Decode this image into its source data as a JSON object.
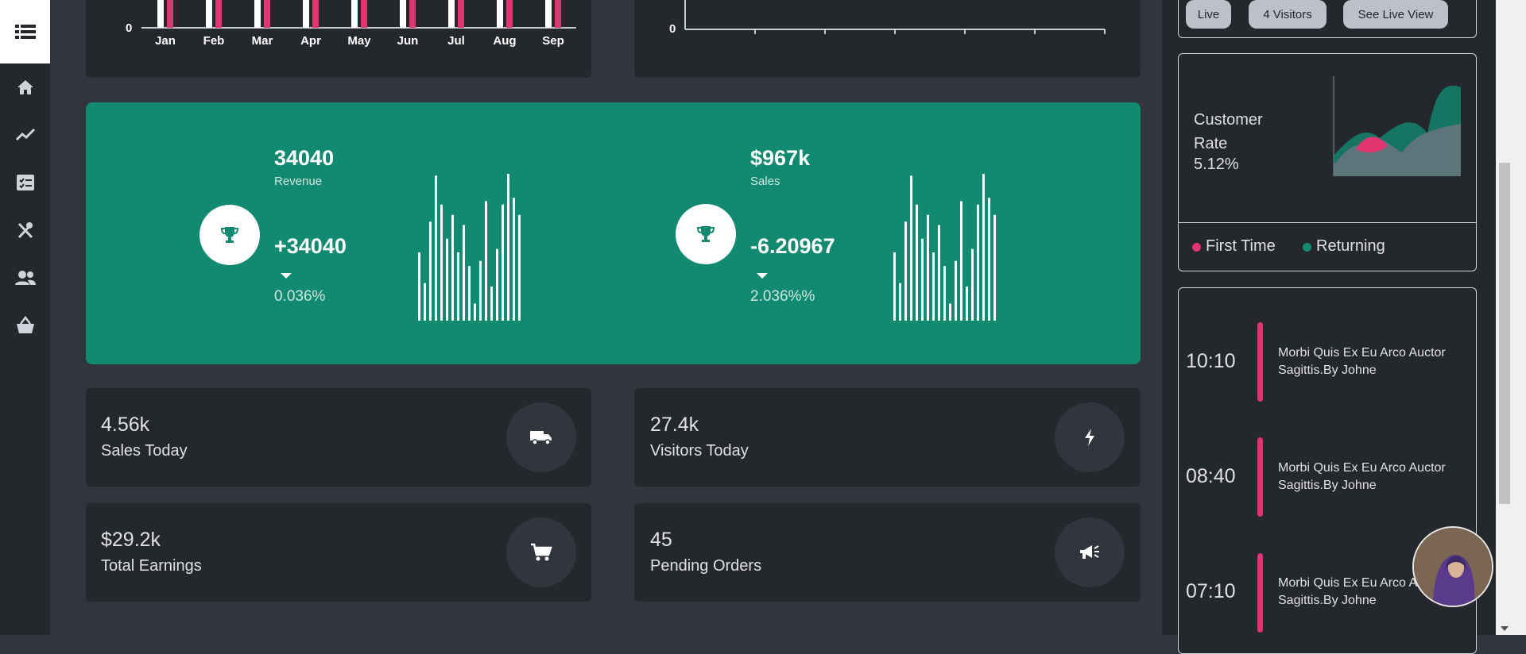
{
  "top_bar_chart": {
    "categories": [
      "Jan",
      "Feb",
      "Mar",
      "Apr",
      "May",
      "Jun",
      "Jul",
      "Aug",
      "Sep"
    ],
    "zero_label": "0",
    "white_bar_color": "#ffffff",
    "pink_bar_color": "#e0356f"
  },
  "top_line_chart": {
    "zero_label": "0"
  },
  "green_panel": {
    "accent": "#128971",
    "left": {
      "value": "34040",
      "label": "Revenue",
      "change": "+34040",
      "percent": "0.036%"
    },
    "right": {
      "value": "$967k",
      "label": "Sales",
      "change": "-6.20967",
      "percent": "2.036%%"
    },
    "sparkline_left": [
      40,
      22,
      58,
      85,
      68,
      48,
      62,
      40,
      56,
      32,
      10,
      35,
      70,
      20,
      42,
      68,
      86,
      72,
      62
    ],
    "sparkline_right": [
      40,
      22,
      58,
      85,
      68,
      48,
      62,
      40,
      56,
      32,
      10,
      35,
      70,
      20,
      42,
      68,
      86,
      72,
      62
    ]
  },
  "stats": [
    {
      "value": "4.56k",
      "label": "Sales Today",
      "icon": "truck-icon"
    },
    {
      "value": "27.4k",
      "label": "Visitors Today",
      "icon": "bolt-icon"
    },
    {
      "value": "$29.2k",
      "label": "Total Earnings",
      "icon": "cart-icon"
    },
    {
      "value": "45",
      "label": "Pending Orders",
      "icon": "megaphone-icon"
    }
  ],
  "live_buttons": {
    "live": "Live",
    "visitors": "4 Visitors",
    "see_live": "See Live View"
  },
  "customer_rate": {
    "title": "Customer Rate",
    "value": "5.12%",
    "legend_first": "First Time",
    "legend_returning": "Returning",
    "first_color": "#e0356f",
    "returning_color": "#128971"
  },
  "timeline": [
    {
      "time": "10:10",
      "text": "Morbi Quis Ex Eu Arco Auctor Sagittis.By Johne"
    },
    {
      "time": "08:40",
      "text": "Morbi Quis Ex Eu Arco Auctor Sagittis.By Johne"
    },
    {
      "time": "07:10",
      "text": "Morbi Quis Ex Eu Arco Auctor Sagittis.By Johne"
    }
  ]
}
